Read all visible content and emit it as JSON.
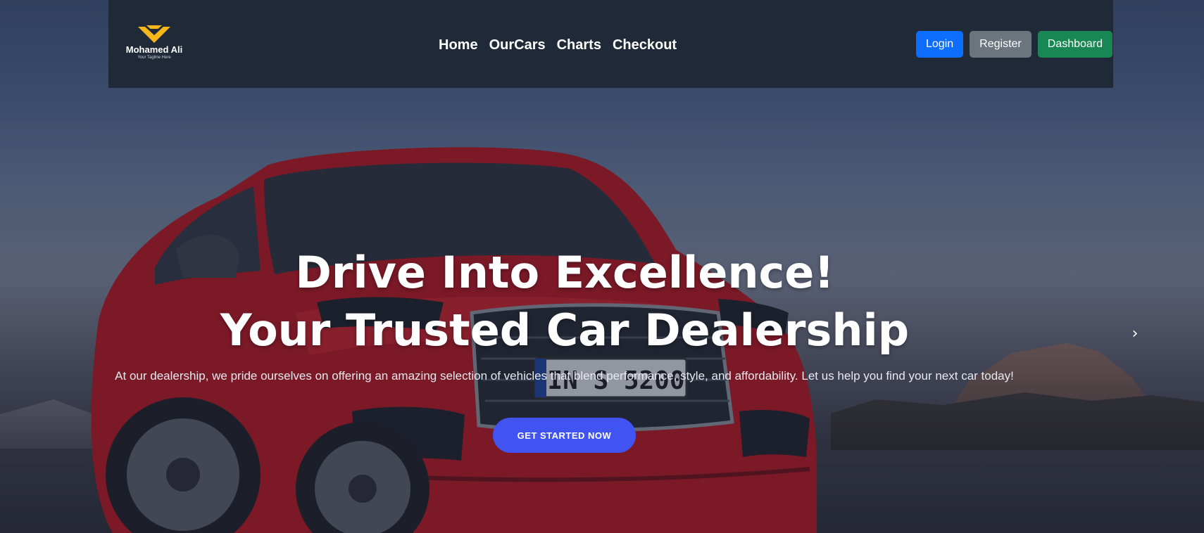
{
  "brand": {
    "name": "Mohamed Ali",
    "tagline": "Your Tagline Here",
    "accent_color": "#f5b71a"
  },
  "nav": {
    "links": [
      {
        "label": "Home"
      },
      {
        "label": "OurCars"
      },
      {
        "label": "Charts"
      },
      {
        "label": "Checkout"
      }
    ],
    "buttons": {
      "login": "Login",
      "register": "Register",
      "dashboard": "Dashboard"
    },
    "colors": {
      "navbar_bg": "#1f2937",
      "login": "#0d6efd",
      "register": "#6c757d",
      "dashboard": "#198754"
    }
  },
  "hero": {
    "headline_line1": "Drive Into Excellence!",
    "headline_line2": "Your Trusted Car Dealership",
    "description": "At our dealership, we pride ourselves on offering an amazing selection of vehicles that blend performance, style, and affordability. Let us help you find your next car today!",
    "cta_label": "GET STARTED NOW",
    "cta_color": "#4154f1",
    "license_plate": "IN S 5200",
    "carousel_next_icon": "chevron-right-icon"
  }
}
